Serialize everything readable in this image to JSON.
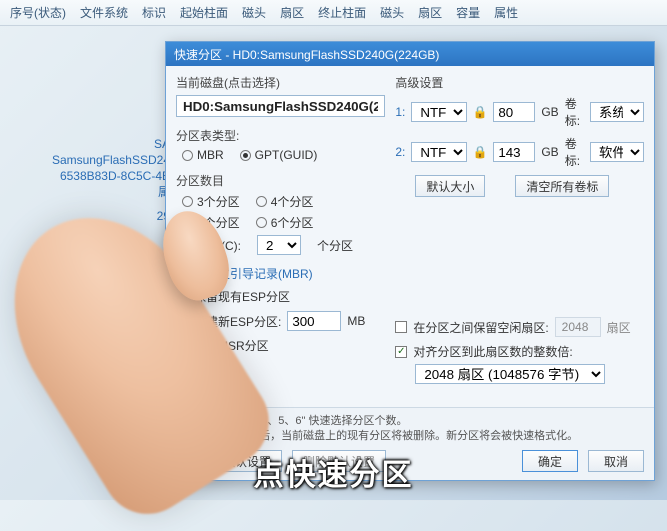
{
  "toolbar": {
    "items": [
      "序号(状态)",
      "文件系统",
      "标识",
      "起始柱面",
      "磁头",
      "扇区",
      "终止柱面",
      "磁头",
      "扇区",
      "容量",
      "属性"
    ]
  },
  "sidebar": {
    "line1": "SA",
    "line2": "SamsungFlashSSD24",
    "line3": "6538B83D-8C5C-4B",
    "line4": "属",
    "line5": "29"
  },
  "dialog": {
    "title": "快速分区 - HD0:SamsungFlashSSD240G(224GB)",
    "disk_group_label": "当前磁盘(点击选择)",
    "disk_value": "HD0:SamsungFlashSSD240G(2",
    "pt_label": "分区表类型:",
    "pt_mbr": "MBR",
    "pt_gpt": "GPT(GUID)",
    "count_label": "分区数目",
    "count_opts": [
      "3个分区",
      "4个分区",
      "5个分区",
      "6个分区"
    ],
    "custom_label": "自定(C):",
    "custom_value": "2",
    "custom_suffix": "个分区",
    "cb_mbr": "重建主引导记录(MBR)",
    "cb_keep": "保留现有ESP分区",
    "cb_esp": "创建新ESP分区:",
    "esp_value": "300",
    "esp_unit": "MB",
    "cb_msr": "创建MSR分区",
    "adv_label": "高级设置",
    "rows": [
      {
        "idx": "1:",
        "fs": "NTFS",
        "size": "80",
        "unit": "GB",
        "vol_lbl": "卷标:",
        "vol": "系统"
      },
      {
        "idx": "2:",
        "fs": "NTFS",
        "size": "143",
        "unit": "GB",
        "vol_lbl": "卷标:",
        "vol": "软件"
      }
    ],
    "btn_default_size": "默认大小",
    "btn_clear_labels": "清空所有卷标",
    "cb_gap": "在分区之间保留空闲扇区:",
    "gap_value": "2048",
    "gap_unit": "扇区",
    "cb_align": "对齐分区到此扇区数的整数倍:",
    "align_value": "2048 扇区 (1048576 字节)",
    "hint1": "提示: 可按下 \"3、4、5、6\" 快速选择分区个数。",
    "hint2": "注意: 此功能执行后，当前磁盘上的现有分区将被删除。新分区将会被快速格式化。",
    "btn_save": "保存为默认设置",
    "btn_reset": "删除默认设置",
    "btn_ok": "确定",
    "btn_cancel": "取消"
  },
  "caption": "点快速分区"
}
